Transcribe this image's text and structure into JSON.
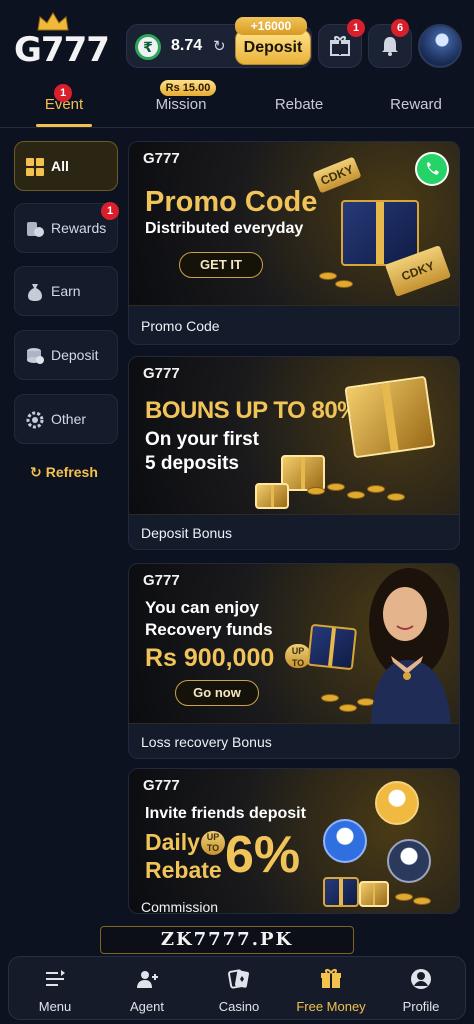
{
  "header": {
    "logo_text": "G777",
    "balance": "8.74",
    "currency_symbol": "₹",
    "deposit_label": "Deposit",
    "deposit_bonus": "+16000",
    "gift_badge": "1",
    "bell_badge": "6"
  },
  "tabs": [
    {
      "label": "Event",
      "badge": "1",
      "active": true
    },
    {
      "label": "Mission",
      "pill": "Rs 15.00"
    },
    {
      "label": "Rebate"
    },
    {
      "label": "Reward"
    }
  ],
  "sidebar": {
    "items": [
      {
        "label": "All",
        "active": true
      },
      {
        "label": "Rewards",
        "badge": "1"
      },
      {
        "label": "Earn"
      },
      {
        "label": "Deposit"
      },
      {
        "label": "Other"
      }
    ],
    "refresh_label": "Refresh"
  },
  "cards": [
    {
      "title": "Promo Code",
      "banner": {
        "logo": "G777",
        "headline": "Promo Code",
        "subline": "Distributed everyday",
        "button": "GET IT",
        "ticket1": "CDKY",
        "ticket2": "CDKY"
      }
    },
    {
      "title": "Deposit Bonus",
      "banner": {
        "logo": "G777",
        "headline": "BOUNS UP TO 80%",
        "line1": "On your first",
        "line2": "5 deposits"
      }
    },
    {
      "title": "Loss recovery Bonus",
      "banner": {
        "logo": "G777",
        "line1": "You can enjoy",
        "line2": "Recovery funds",
        "amount": "Rs 900,000",
        "upto": "UP TO",
        "button": "Go now"
      }
    },
    {
      "title": "Commission",
      "banner": {
        "logo": "G777",
        "line1": "Invite friends deposit",
        "daily": "Daily",
        "rebate": "Rebate",
        "upto": "UP TO",
        "percent": "6%"
      }
    }
  ],
  "domain_text": "ZK7777.PK",
  "bottom_nav": [
    {
      "label": "Menu",
      "icon": "menu-icon"
    },
    {
      "label": "Agent",
      "icon": "agent-icon"
    },
    {
      "label": "Casino",
      "icon": "casino-icon"
    },
    {
      "label": "Free Money",
      "icon": "gift-icon",
      "active": true
    },
    {
      "label": "Profile",
      "icon": "profile-icon"
    }
  ],
  "colors": {
    "accent": "#f2c14e",
    "background": "#0d1220",
    "badge": "#d81f2b"
  }
}
